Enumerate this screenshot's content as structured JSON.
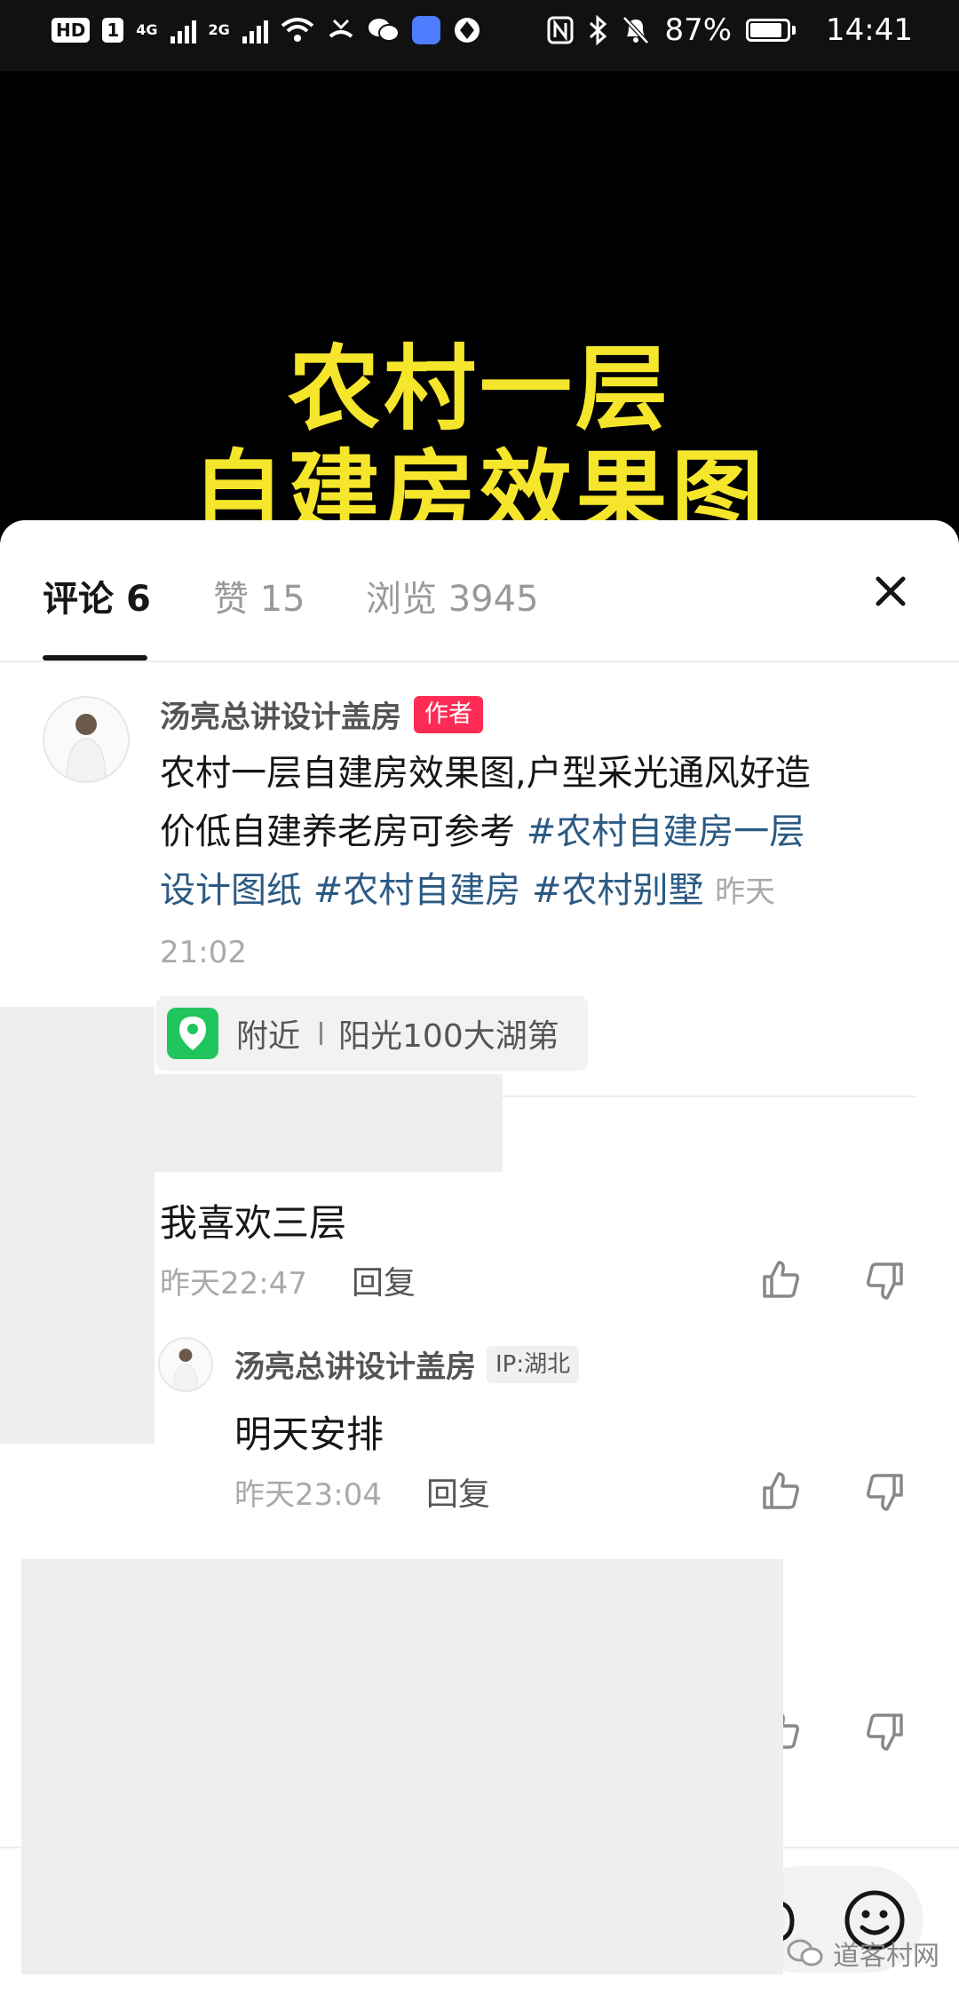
{
  "status_bar": {
    "hd_badge": "HD",
    "sim_slot": "1",
    "net1": "4G",
    "net2": "2G",
    "battery": "87%",
    "battery_level": 0.87,
    "time": "14:41"
  },
  "video": {
    "title_line1": "农村一层",
    "title_line2": "自建房效果图",
    "title_color": "#f5e62b"
  },
  "tabs": [
    {
      "label": "评论",
      "count": "6"
    },
    {
      "label": "赞",
      "count": "15"
    },
    {
      "label": "浏览",
      "count": "3945"
    }
  ],
  "post": {
    "author": "汤亮总讲设计盖房",
    "author_tag": "作者",
    "text": "农村一层自建房效果图,户型采光通风好造价低自建养老房可参考",
    "hashtags": [
      "#农村自建房一层设计图纸",
      "#农村自建房",
      "#农村别墅"
    ],
    "time": "昨天21:02",
    "location_prefix": "附近",
    "location": "阳光100大湖第"
  },
  "comments": [
    {
      "text": "我喜欢三层",
      "time": "昨天22:47",
      "reply_label": "回复",
      "replies": [
        {
          "author": "汤亮总讲设计盖房",
          "ip": "IP:湖北",
          "text": "明天安排",
          "time": "昨天23:04",
          "reply_label": "回复"
        }
      ]
    }
  ],
  "watermark": "道客村网",
  "colors": {
    "accent": "#fe2c55",
    "hashtag": "#2b5a84",
    "location_green": "#21c55d"
  }
}
